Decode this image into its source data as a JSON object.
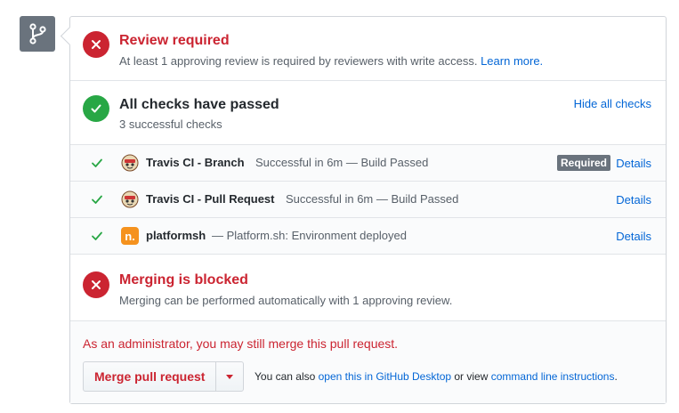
{
  "review": {
    "title": "Review required",
    "subtitle": "At least 1 approving review is required by reviewers with write access.",
    "learn_more": "Learn more."
  },
  "checks": {
    "title": "All checks have passed",
    "subtitle": "3 successful checks",
    "hide_link": "Hide all checks",
    "items": [
      {
        "name": "Travis CI - Branch",
        "description": "Successful in 6m — Build Passed",
        "required_badge": "Required",
        "details": "Details",
        "icon": "travis-ci-icon"
      },
      {
        "name": "Travis CI - Pull Request",
        "description": "Successful in 6m — Build Passed",
        "details": "Details",
        "icon": "travis-ci-icon"
      },
      {
        "name": "platformsh",
        "description": "— Platform.sh: Environment deployed",
        "details": "Details",
        "icon": "platformsh-icon",
        "icon_letter": "n."
      }
    ]
  },
  "blocked": {
    "title": "Merging is blocked",
    "subtitle": "Merging can be performed automatically with 1 approving review."
  },
  "merge": {
    "admin_note": "As an administrator, you may still merge this pull request.",
    "button_label": "Merge pull request",
    "also_prefix": "You can also ",
    "desktop_link": "open this in GitHub Desktop",
    "or_view": " or view ",
    "cli_link": "command line instructions",
    "suffix": "."
  },
  "colors": {
    "danger": "#cb2431",
    "success": "#28a745",
    "link": "#0366d6",
    "badge": "#6a737d"
  }
}
